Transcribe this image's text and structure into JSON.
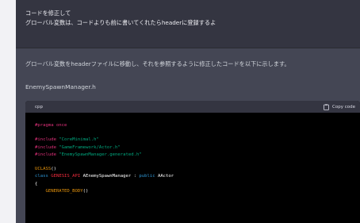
{
  "user_message": {
    "line1": "コードを修正して",
    "line2": "グローバル変数は、コードよりも前に書いてくれたらheaderに登録するよ"
  },
  "assistant": {
    "intro": "グローバル変数をheaderファイルに移動し、それを参照するように修正したコードを以下に示します。",
    "filename": "EnemySpawnManager.h"
  },
  "code_block": {
    "language": "cpp",
    "copy_label": "Copy code",
    "copy_icon": "clipboard-icon",
    "lines": {
      "l1": "#pragma once",
      "l3a": "#include ",
      "l3b": "\"CoreMinimal.h\"",
      "l4a": "#include ",
      "l4b": "\"GameFramework/Actor.h\"",
      "l5a": "#include ",
      "l5b": "\"EnemySpawnManager.generated.h\"",
      "l7a": "UCLASS",
      "l7b": "()",
      "l8a": "class ",
      "l8b": "GENESIS_API",
      "l8c": " AEnemySpawnManager : ",
      "l8d": "public",
      "l8e": " AActor",
      "l9": "{",
      "l10a": "    GENERATED_BODY",
      "l10b": "()"
    }
  },
  "colors": {
    "user_bg": "#343541",
    "assistant_bg": "#444654",
    "code_bg": "#000000",
    "string": "#00a67d",
    "preprocessor": "#df3079",
    "macro": "#e9950c",
    "keyword": "#2e95d3",
    "class_macro": "#f22c3d"
  }
}
